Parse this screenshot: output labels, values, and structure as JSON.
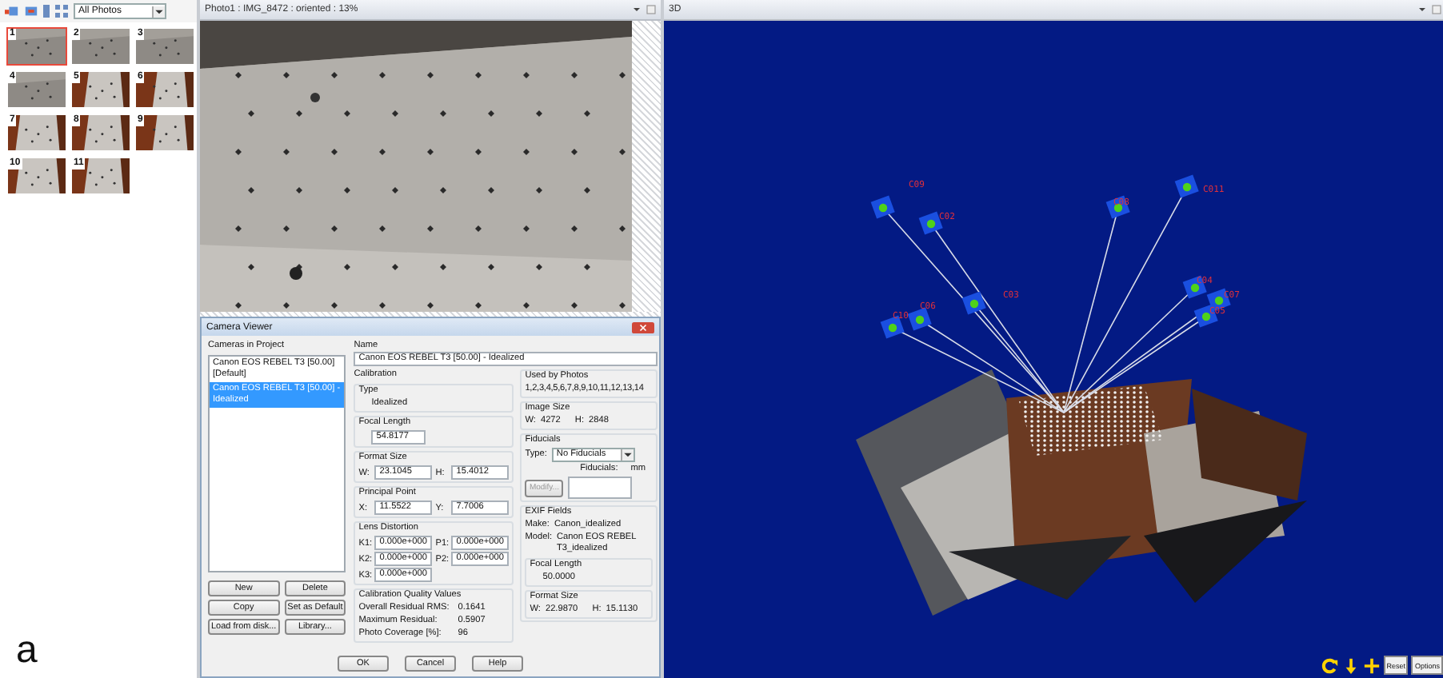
{
  "thumbnail_toolbar": {
    "filter": "All Photos"
  },
  "thumbnails": [
    {
      "label": "1",
      "selected": true
    },
    {
      "label": "2",
      "selected": false
    },
    {
      "label": "3",
      "selected": false
    },
    {
      "label": "4",
      "selected": false
    },
    {
      "label": "5",
      "selected": false
    },
    {
      "label": "6",
      "selected": false
    },
    {
      "label": "7",
      "selected": false
    },
    {
      "label": "8",
      "selected": false
    },
    {
      "label": "9",
      "selected": false
    },
    {
      "label": "10",
      "selected": false
    },
    {
      "label": "11",
      "selected": false
    }
  ],
  "figure_label": "a",
  "photo_panel": {
    "title": "Photo1 : IMG_8472 : oriented : 13%"
  },
  "camera_viewer": {
    "title": "Camera Viewer",
    "cameras_label": "Cameras in Project",
    "cameras": [
      {
        "name": "Canon EOS REBEL T3 [50.00] [Default]",
        "selected": false
      },
      {
        "name": "Canon EOS REBEL T3 [50.00] - Idealized",
        "selected": true
      }
    ],
    "list_buttons": [
      "New",
      "Delete",
      "Copy",
      "Set as Default",
      "Load from disk...",
      "Library..."
    ],
    "name_label": "Name",
    "name": "Canon EOS REBEL T3 [50.00] - Idealized",
    "calibration": {
      "title": "Calibration",
      "type": {
        "label": "Type",
        "value": "Idealized"
      },
      "focal_length": {
        "label": "Focal Length",
        "value": "54.8177"
      },
      "format_size": {
        "label": "Format Size",
        "fields": [
          {
            "label": "W:",
            "value": "23.1045"
          },
          {
            "label": "H:",
            "value": "15.4012"
          }
        ]
      },
      "principal_point": {
        "label": "Principal Point",
        "fields": [
          {
            "label": "X:",
            "value": "11.5522"
          },
          {
            "label": "Y:",
            "value": "7.7006"
          }
        ]
      },
      "lens_distortion": {
        "label": "Lens Distortion",
        "fields": [
          {
            "label": "K1:",
            "value": "0.000e+000"
          },
          {
            "label": "P1:",
            "value": "0.000e+000"
          },
          {
            "label": "K2:",
            "value": "0.000e+000"
          },
          {
            "label": "P2:",
            "value": "0.000e+000"
          },
          {
            "label": "K3:",
            "value": "0.000e+000"
          }
        ]
      }
    },
    "quality": {
      "label": "Calibration Quality Values",
      "rows": [
        {
          "label": "Overall Residual RMS:",
          "value": "0.1641"
        },
        {
          "label": "Maximum Residual:",
          "value": "0.5907"
        },
        {
          "label": "Photo Coverage [%]:",
          "value": "96"
        }
      ]
    },
    "used_by": {
      "label": "Used by Photos",
      "value": "1,2,3,4,5,6,7,8,9,10,11,12,13,14"
    },
    "image_size": {
      "label": "Image Size",
      "fields": [
        {
          "label": "W:",
          "value": "4272"
        },
        {
          "label": "H:",
          "value": "2848"
        }
      ]
    },
    "fiducials": {
      "label": "Fiducials",
      "type_label": "Type:",
      "type": "No Fiducials",
      "list_label": "Fiducials:",
      "unit": "mm",
      "modify": {
        "label": "Modify...",
        "disabled": true
      }
    },
    "exif": {
      "label": "EXIF Fields",
      "make_label": "Make:",
      "make": "Canon_idealized",
      "model_label": "Model:",
      "model": "Canon EOS REBEL T3_idealized",
      "focal_length": {
        "label": "Focal Length",
        "value": "50.0000"
      },
      "format_size": {
        "label": "Format Size",
        "fields": [
          {
            "label": "W:",
            "value": "22.9870"
          },
          {
            "label": "H:",
            "value": "15.1130"
          }
        ]
      }
    },
    "dialog_buttons": [
      "OK",
      "Cancel",
      "Help"
    ]
  },
  "view_3d": {
    "title": "3D",
    "camera_labels": [
      "C09",
      "C02",
      "C03",
      "C06",
      "C10",
      "C08",
      "C011",
      "C04",
      "C07",
      "C05"
    ],
    "tool_buttons": [
      "Reset",
      "Options"
    ]
  }
}
